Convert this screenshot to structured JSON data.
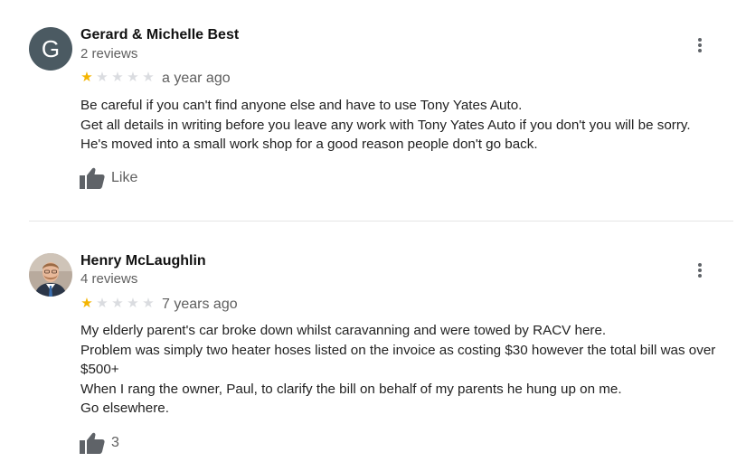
{
  "reviews": [
    {
      "reviewer_name": "Gerard & Michelle Best",
      "reviewer_count": "2 reviews",
      "avatar_letter": "G",
      "avatar_color": "#4b5a62",
      "rating": 1,
      "rating_max": 5,
      "date": "a year ago",
      "lines": [
        "Be careful if you can't find anyone else and have to use Tony Yates Auto.",
        "Get all details in writing before you leave any work with Tony Yates Auto if you don't  you will be sorry.",
        "He's moved into a small work shop for a good reason people don't go back."
      ],
      "like_label": "Like",
      "like_icon": "thumbs-up-icon",
      "menu_icon": "more-vert-icon"
    },
    {
      "reviewer_name": "Henry McLaughlin",
      "reviewer_count": "4 reviews",
      "avatar_icon": "profile-photo",
      "rating": 1,
      "rating_max": 5,
      "date": "7 years ago",
      "lines": [
        "My elderly parent's car broke down whilst caravanning and were towed by RACV here.",
        "Problem was simply two heater hoses listed on the invoice as costing $30 however the total bill was over $500+",
        "When I rang the owner, Paul, to clarify the bill on behalf of my parents he hung up on me.",
        "Go elsewhere."
      ],
      "like_label": "3",
      "like_icon": "thumbs-up-icon",
      "menu_icon": "more-vert-icon"
    }
  ],
  "colors": {
    "star_filled": "#f4b400",
    "star_empty": "#dadce0",
    "icon_gray": "#5f6368"
  }
}
